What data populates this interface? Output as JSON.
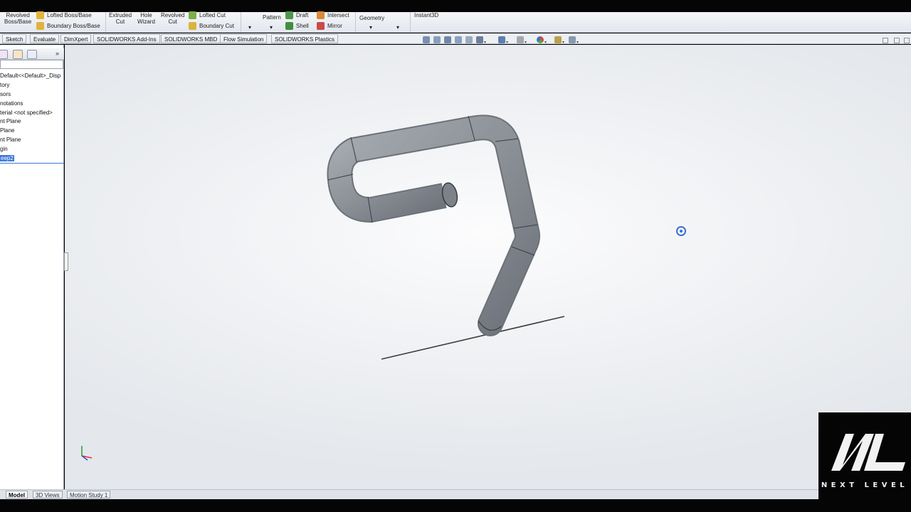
{
  "ribbon": {
    "revolved_boss": "Revolved\nBoss/Base",
    "lofted_boss": "Lofted Boss/Base",
    "boundary_boss": "Boundary Boss/Base",
    "extruded_cut": "Extruded\nCut",
    "hole_wizard": "Hole\nWizard",
    "revolved_cut": "Revolved\nCut",
    "lofted_cut": "Lofted Cut",
    "boundary_cut": "Boundary Cut",
    "pattern": "Pattern",
    "draft": "Draft",
    "intersect": "Intersect",
    "shell": "Shell",
    "mirror": "Mirror",
    "reference_geometry": "Geometry",
    "instant3d": "Instant3D"
  },
  "tabs": [
    "Sketch",
    "Evaluate",
    "DimXpert",
    "SOLIDWORKS Add-Ins",
    "SOLIDWORKS MBD",
    "Flow Simulation",
    "SOLIDWORKS Plastics"
  ],
  "feature_tree": {
    "items": [
      "Default<<Default>_Disp",
      "tory",
      "sors",
      "notations",
      "terial <not specified>",
      "nt Plane",
      " Plane",
      "nt Plane",
      "gin",
      "eep2"
    ]
  },
  "bottom_tabs": [
    "Model",
    "3D Views",
    "Motion Study 1"
  ],
  "watermark": {
    "monogram": "NL",
    "text": "NEXT LEVEL"
  },
  "colors": {
    "ribbon_bg": "#e8ebf0",
    "viewport_bg": "#f2f3f5",
    "tube_gray": "#8f939b",
    "selection_blue": "#3a79d6"
  }
}
